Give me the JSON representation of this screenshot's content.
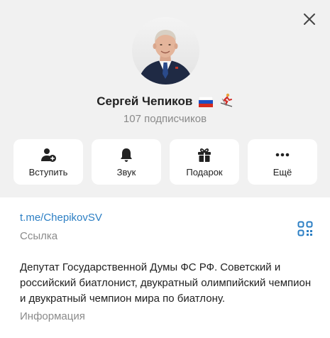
{
  "profile": {
    "name": "Сергей Чепиков",
    "flag_icon": "russia-flag-icon",
    "sport_icon": "skier-icon",
    "subscribers": "107 подписчиков"
  },
  "actions": [
    {
      "label": "Вступить",
      "icon": "add-user-icon"
    },
    {
      "label": "Звук",
      "icon": "bell-icon"
    },
    {
      "label": "Подарок",
      "icon": "gift-icon"
    },
    {
      "label": "Ещё",
      "icon": "more-icon"
    }
  ],
  "info": {
    "link": "t.me/ChepikovSV",
    "link_caption": "Ссылка",
    "bio": "Депутат Государственной Думы ФС РФ. Советский и российский биатлонист, двукратный олимпийский чемпион и двукратный чемпион мира по биатлону.",
    "bio_caption": "Информация"
  },
  "colors": {
    "header_bg": "#f1f1f1",
    "link": "#2c7fc4",
    "muted": "#8a8a8a"
  }
}
